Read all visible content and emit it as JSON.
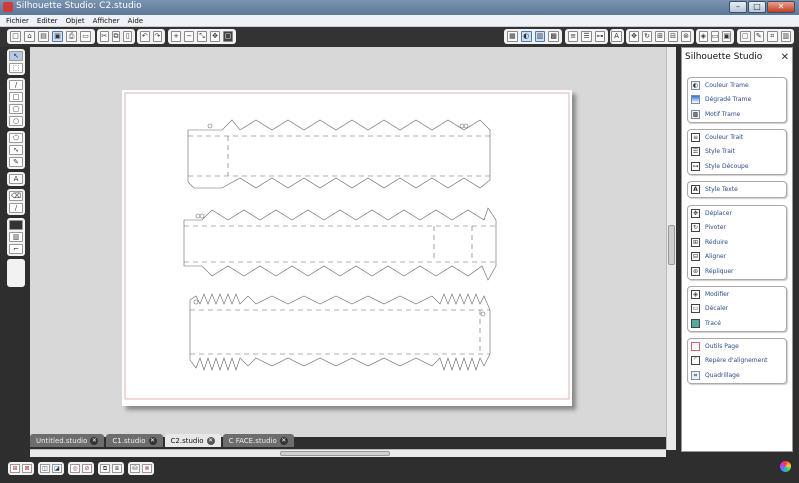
{
  "window": {
    "title": "Silhouette Studio: C2.studio",
    "minimize": "–",
    "maximize": "□",
    "close": "✕"
  },
  "menu": [
    "Fichier",
    "Editer",
    "Objet",
    "Afficher",
    "Aide"
  ],
  "toolbar": {
    "left_icons": [
      "new-file-icon",
      "open-file-icon",
      "save-icon",
      "save-to-library-icon",
      "print-icon",
      "send-to-cutter-icon",
      "cut-icon",
      "copy-icon",
      "paste-icon",
      "undo-icon",
      "redo-icon",
      "zoom-in-icon",
      "zoom-out-icon",
      "zoom-select-icon",
      "pan-icon",
      "fit-page-icon"
    ],
    "right_icons": [
      "store-icon",
      "fill-color-icon",
      "gradient-icon",
      "pattern-icon",
      "line-color-icon",
      "line-style-icon",
      "cut-style-icon",
      "text-style-icon",
      "move-icon",
      "rotate-icon",
      "scale-icon",
      "align-icon",
      "replicate-icon",
      "modify-icon",
      "offset-icon",
      "trace-icon",
      "page-icon",
      "pen-icon",
      "grid-icon",
      "library-icon"
    ]
  },
  "left_tools": [
    [
      "select-tool",
      "point-edit-tool"
    ],
    [
      "line-tool",
      "rectangle-tool",
      "rounded-rectangle-tool",
      "ellipse-tool"
    ],
    [
      "polygon-tool",
      "curve-tool",
      "freehand-tool"
    ],
    [
      "text-tool"
    ],
    [
      "eraser-tool",
      "knife-tool"
    ],
    [
      "monitor-tool",
      "library-tool",
      "registration-tool"
    ],
    [
      "zoom-slider"
    ]
  ],
  "tabs": [
    {
      "label": "Untitled.studio",
      "active": false
    },
    {
      "label": "C1.studio",
      "active": false
    },
    {
      "label": "C2.studio",
      "active": true
    },
    {
      "label": "C FACE.studio",
      "active": false
    }
  ],
  "tab_close_glyph": "✕",
  "panel": {
    "title": "Silhouette Studio",
    "close_glyph": "✕",
    "groups": [
      {
        "items": [
          {
            "icon": "fill-color-icon",
            "label": "Couleur Trame"
          },
          {
            "icon": "gradient-fill-icon",
            "label": "Dégradé Trame"
          },
          {
            "icon": "pattern-fill-icon",
            "label": "Motif Trame"
          }
        ]
      },
      {
        "items": [
          {
            "icon": "line-color-icon",
            "label": "Couleur Trait"
          },
          {
            "icon": "line-style-icon",
            "label": "Style Trait"
          },
          {
            "icon": "cut-style-icon",
            "label": "Style Découpe"
          }
        ]
      },
      {
        "items": [
          {
            "icon": "text-style-icon",
            "label": "Style Texte"
          }
        ]
      },
      {
        "items": [
          {
            "icon": "move-icon",
            "label": "Déplacer"
          },
          {
            "icon": "rotate-icon",
            "label": "Pivoter"
          },
          {
            "icon": "scale-icon",
            "label": "Réduire"
          },
          {
            "icon": "align-icon",
            "label": "Aligner"
          },
          {
            "icon": "replicate-icon",
            "label": "Répliquer"
          }
        ]
      },
      {
        "items": [
          {
            "icon": "modify-icon",
            "label": "Modifier"
          },
          {
            "icon": "offset-icon",
            "label": "Décaler"
          },
          {
            "icon": "trace-icon",
            "label": "Tracé"
          }
        ]
      },
      {
        "items": [
          {
            "icon": "page-tools-icon",
            "label": "Outils Page"
          },
          {
            "icon": "registration-marks-icon",
            "label": "Repère d'alignement"
          },
          {
            "icon": "grid-icon",
            "label": "Quadrillage"
          }
        ]
      }
    ]
  },
  "bottom_icons": [
    "group-icon",
    "ungroup-icon",
    "make-compound-icon",
    "release-compound-icon",
    "weld-icon",
    "subtract-icon",
    "bring-forward-icon",
    "send-backward-icon",
    "fill-bucket-icon",
    "no-fill-icon"
  ],
  "colors": {
    "cut_line": "#666666",
    "page_border": "#d9a0a0",
    "accent": "#2b4a8a"
  }
}
